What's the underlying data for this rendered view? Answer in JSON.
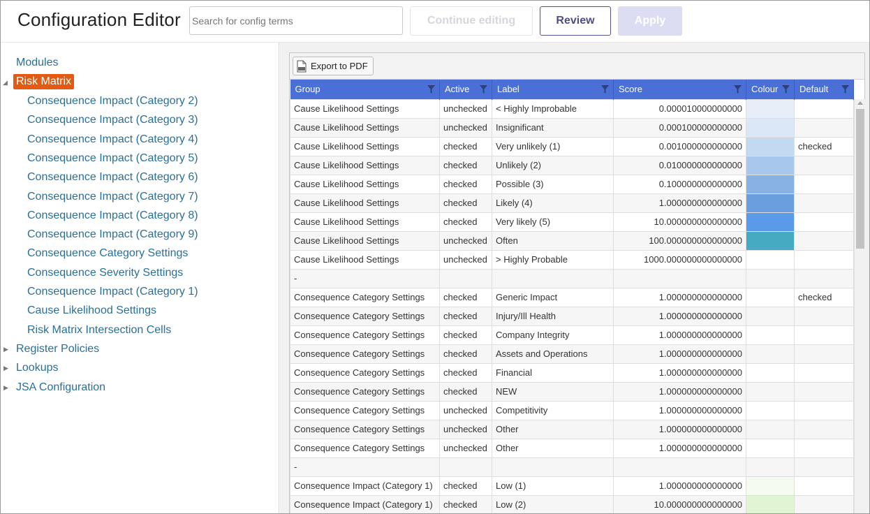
{
  "header": {
    "title": "Configuration Editor",
    "search_placeholder": "Search for config terms",
    "continue_label": "Continue editing",
    "review_label": "Review",
    "apply_label": "Apply"
  },
  "sidebar": {
    "modules_label": "Modules",
    "risk_matrix_label": "Risk Matrix",
    "children": [
      "Consequence Impact (Category 2)",
      "Consequence Impact (Category 3)",
      "Consequence Impact (Category 4)",
      "Consequence Impact (Category 5)",
      "Consequence Impact (Category 6)",
      "Consequence Impact (Category 7)",
      "Consequence Impact (Category 8)",
      "Consequence Impact (Category 9)",
      "Consequence Category Settings",
      "Consequence Severity Settings",
      "Consequence Impact (Category 1)",
      "Cause Likelihood Settings",
      "Risk Matrix Intersection Cells"
    ],
    "register_policies_label": "Register Policies",
    "lookups_label": "Lookups",
    "jsa_label": "JSA Configuration"
  },
  "grid": {
    "export_label": "Export to PDF",
    "columns": [
      "Group",
      "Active",
      "Label",
      "Score",
      "Colour",
      "Default"
    ],
    "rows": [
      {
        "group": "Cause Likelihood Settings",
        "active": "unchecked",
        "label": "< Highly Improbable",
        "score": "0.000010000000000",
        "colour": "#e7eef8",
        "default": ""
      },
      {
        "group": "Cause Likelihood Settings",
        "active": "unchecked",
        "label": "Insignificant",
        "score": "0.000100000000000",
        "colour": "#dbe7f6",
        "default": ""
      },
      {
        "group": "Cause Likelihood Settings",
        "active": "checked",
        "label": "Very unlikely (1)",
        "score": "0.001000000000000",
        "colour": "#c2d9f2",
        "default": "checked"
      },
      {
        "group": "Cause Likelihood Settings",
        "active": "checked",
        "label": "Unlikely (2)",
        "score": "0.010000000000000",
        "colour": "#a8c7ec",
        "default": ""
      },
      {
        "group": "Cause Likelihood Settings",
        "active": "checked",
        "label": "Possible (3)",
        "score": "0.100000000000000",
        "colour": "#89b2e4",
        "default": ""
      },
      {
        "group": "Cause Likelihood Settings",
        "active": "checked",
        "label": "Likely (4)",
        "score": "1.000000000000000",
        "colour": "#6a9fdf",
        "default": ""
      },
      {
        "group": "Cause Likelihood Settings",
        "active": "checked",
        "label": "Very likely (5)",
        "score": "10.000000000000000",
        "colour": "#5a9ae8",
        "default": ""
      },
      {
        "group": "Cause Likelihood Settings",
        "active": "unchecked",
        "label": "Often",
        "score": "100.000000000000000",
        "colour": "#45aac2",
        "default": ""
      },
      {
        "group": "Cause Likelihood Settings",
        "active": "unchecked",
        "label": "> Highly Probable",
        "score": "1000.000000000000000",
        "colour": "",
        "default": ""
      },
      {
        "group": "-",
        "active": "",
        "label": "",
        "score": "",
        "colour": "",
        "default": ""
      },
      {
        "group": "Consequence Category Settings",
        "active": "checked",
        "label": "Generic Impact",
        "score": "1.000000000000000",
        "colour": "",
        "default": "checked"
      },
      {
        "group": "Consequence Category Settings",
        "active": "checked",
        "label": "Injury/Ill Health",
        "score": "1.000000000000000",
        "colour": "",
        "default": ""
      },
      {
        "group": "Consequence Category Settings",
        "active": "checked",
        "label": "Company Integrity",
        "score": "1.000000000000000",
        "colour": "",
        "default": ""
      },
      {
        "group": "Consequence Category Settings",
        "active": "checked",
        "label": "Assets and Operations",
        "score": "1.000000000000000",
        "colour": "",
        "default": ""
      },
      {
        "group": "Consequence Category Settings",
        "active": "checked",
        "label": "Financial",
        "score": "1.000000000000000",
        "colour": "",
        "default": ""
      },
      {
        "group": "Consequence Category Settings",
        "active": "checked",
        "label": "NEW",
        "score": "1.000000000000000",
        "colour": "",
        "default": ""
      },
      {
        "group": "Consequence Category Settings",
        "active": "unchecked",
        "label": "Competitivity",
        "score": "1.000000000000000",
        "colour": "",
        "default": ""
      },
      {
        "group": "Consequence Category Settings",
        "active": "unchecked",
        "label": "Other",
        "score": "1.000000000000000",
        "colour": "",
        "default": ""
      },
      {
        "group": "Consequence Category Settings",
        "active": "unchecked",
        "label": "Other",
        "score": "1.000000000000000",
        "colour": "",
        "default": ""
      },
      {
        "group": "-",
        "active": "",
        "label": "",
        "score": "",
        "colour": "",
        "default": ""
      },
      {
        "group": "Consequence Impact (Category 1)",
        "active": "checked",
        "label": "Low (1)",
        "score": "1.000000000000000",
        "colour": "#f5fbef",
        "default": ""
      },
      {
        "group": "Consequence Impact (Category 1)",
        "active": "checked",
        "label": "Low (2)",
        "score": "10.000000000000000",
        "colour": "#e2f5d2",
        "default": ""
      }
    ]
  },
  "colors": {
    "accent": "#e35b12",
    "header_blue": "#4a6fd6",
    "link": "#2a6f98"
  }
}
